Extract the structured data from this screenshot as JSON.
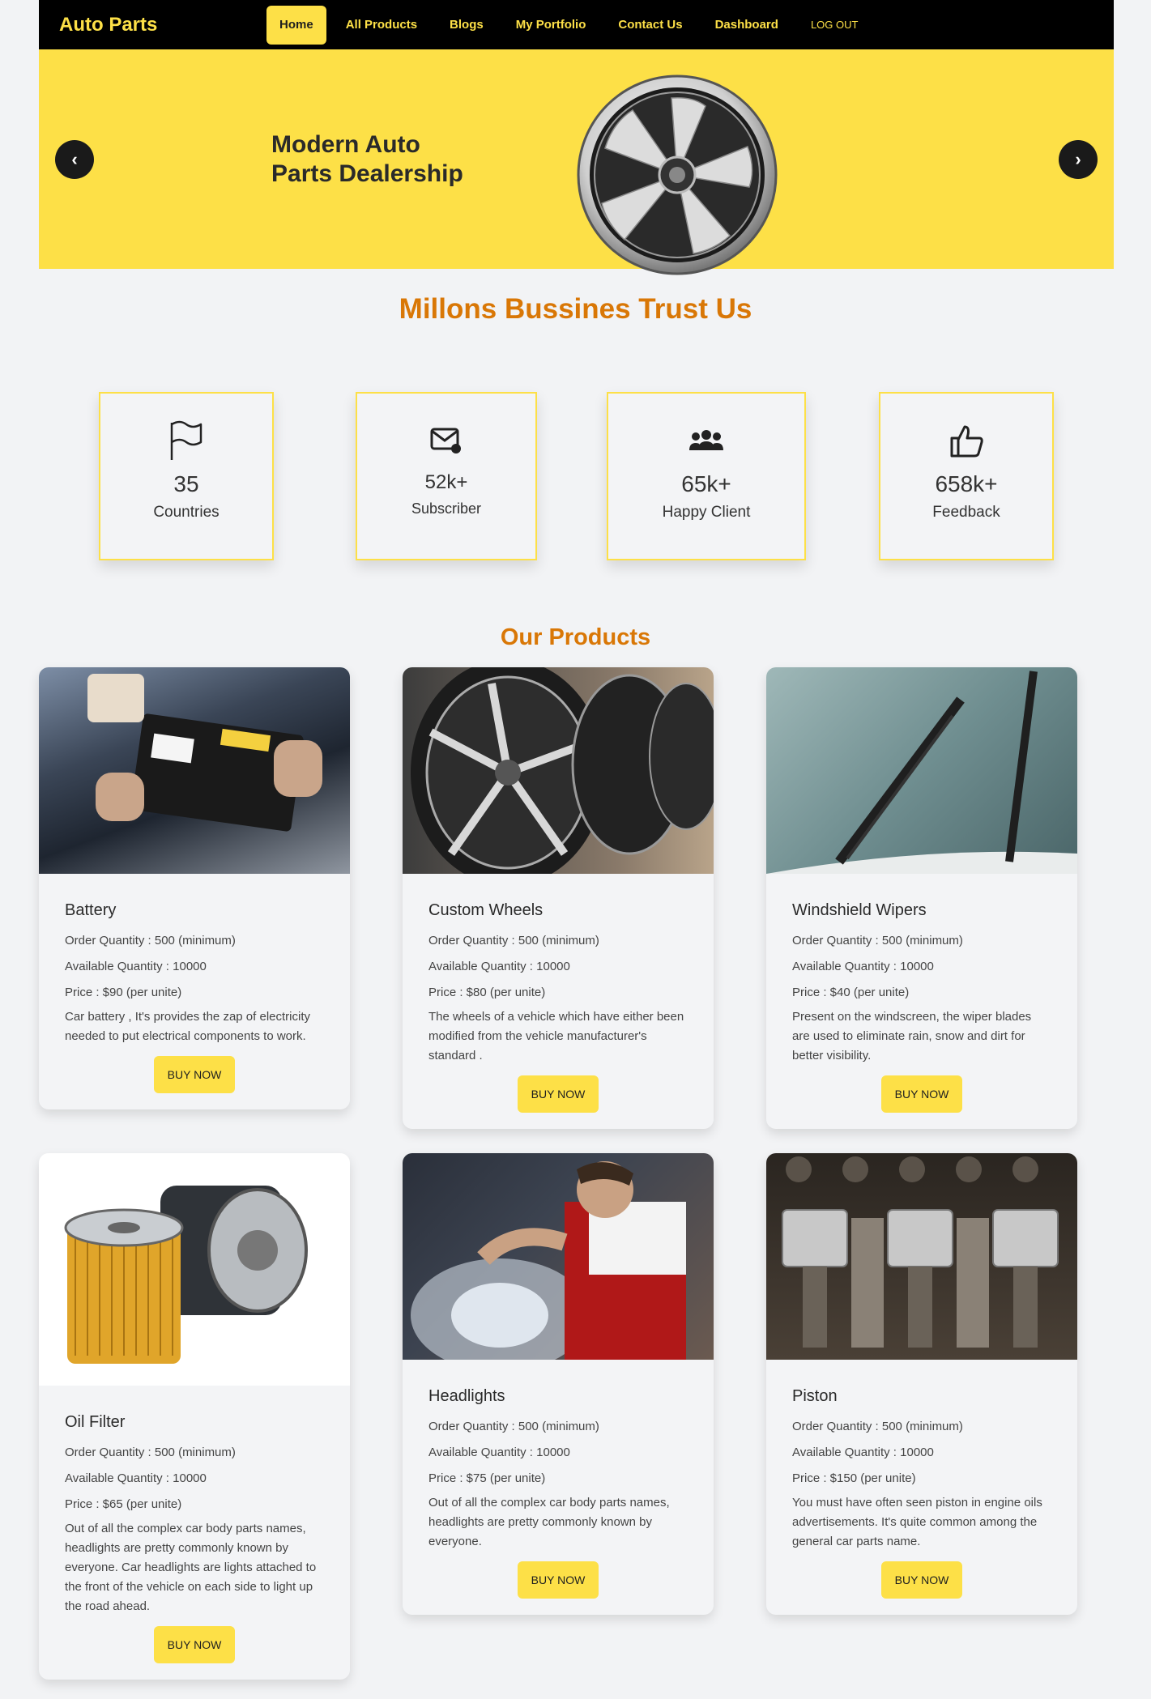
{
  "nav": {
    "brand": "Auto Parts",
    "links": [
      "Home",
      "All Products",
      "Blogs",
      "My Portfolio",
      "Contact Us",
      "Dashboard",
      "LOG OUT"
    ]
  },
  "hero": {
    "title": "Modern Auto Parts Dealership",
    "prev": "‹",
    "next": "›"
  },
  "trust": {
    "title": "Millons Bussines Trust Us",
    "stats": [
      {
        "icon": "flag-icon",
        "value": "35",
        "label": "Countries"
      },
      {
        "icon": "mail-icon",
        "value": "52k+",
        "label": "Subscriber"
      },
      {
        "icon": "users-icon",
        "value": "65k+",
        "label": "Happy Client"
      },
      {
        "icon": "thumbs-up-icon",
        "value": "658k+",
        "label": "Feedback"
      }
    ]
  },
  "products": {
    "title": "Our Products",
    "buy_label": "BUY NOW",
    "items": [
      {
        "name": "Battery",
        "order": "Order Quantity : 500 (minimum)",
        "available": "Available Quantity : 10000",
        "price": "Price : $90 (per unite)",
        "desc": "Car battery , It's provides the zap of electricity needed to put electrical components to work."
      },
      {
        "name": "Custom Wheels",
        "order": "Order Quantity : 500 (minimum)",
        "available": "Available Quantity : 10000",
        "price": "Price : $80 (per unite)",
        "desc": "The wheels of a vehicle which have either been modified from the vehicle manufacturer's standard ."
      },
      {
        "name": "Windshield Wipers",
        "order": "Order Quantity : 500 (minimum)",
        "available": "Available Quantity : 10000",
        "price": "Price : $40 (per unite)",
        "desc": "Present on the windscreen, the wiper blades are used to eliminate rain, snow and dirt for better visibility."
      },
      {
        "name": "Oil Filter",
        "order": "Order Quantity : 500 (minimum)",
        "available": "Available Quantity : 10000",
        "price": "Price : $65 (per unite)",
        "desc": "Out of all the complex car body parts names, headlights are pretty commonly known by everyone. Car headlights are lights attached to the front of the vehicle on each side to light up the road ahead."
      },
      {
        "name": "Headlights",
        "order": "Order Quantity : 500 (minimum)",
        "available": "Available Quantity : 10000",
        "price": "Price : $75 (per unite)",
        "desc": "Out of all the complex car body parts names, headlights are pretty commonly known by everyone."
      },
      {
        "name": "Piston",
        "order": "Order Quantity : 500 (minimum)",
        "available": "Available Quantity : 10000",
        "price": "Price : $150 (per unite)",
        "desc": "You must have often seen piston in engine oils advertisements. It's quite common among the general car parts name."
      }
    ]
  },
  "colors": {
    "accent": "#fde047",
    "heading": "#d97706",
    "nav_bg": "#000000"
  }
}
